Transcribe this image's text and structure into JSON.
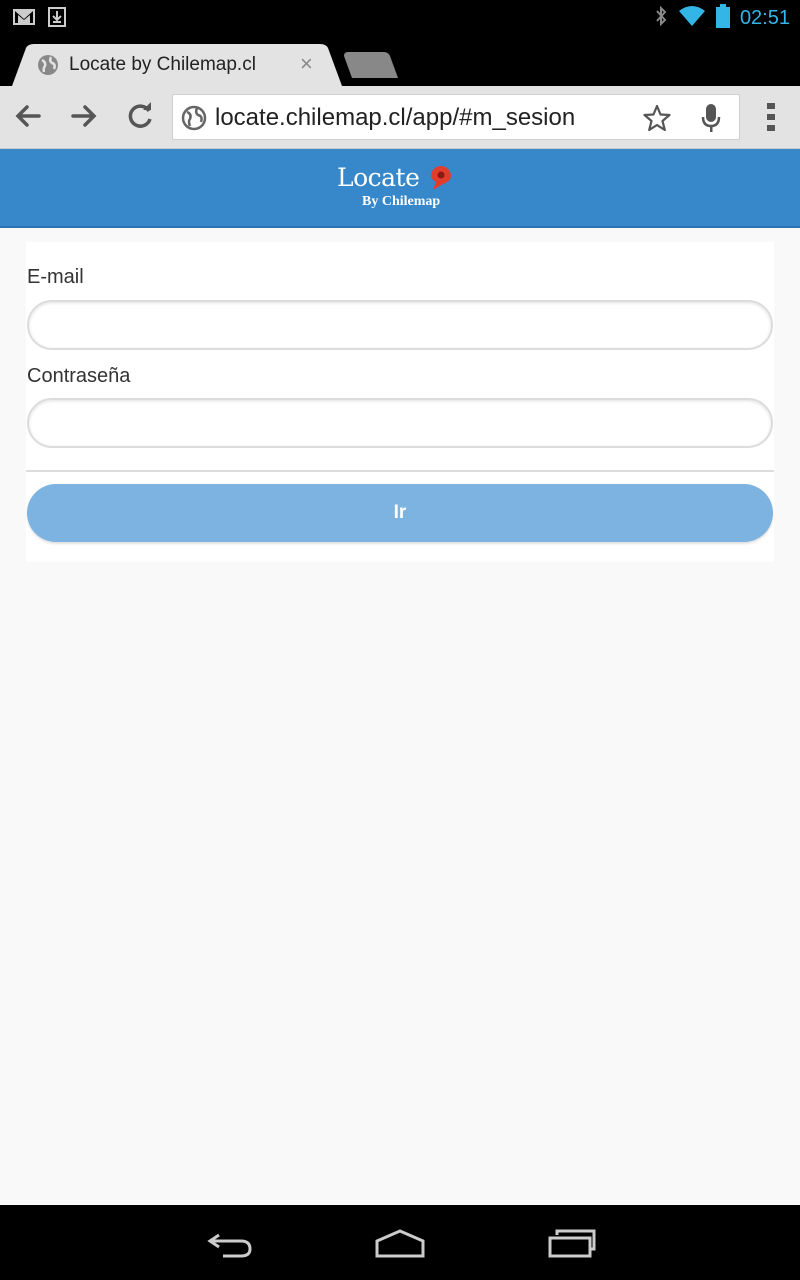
{
  "status_bar": {
    "time": "02:51",
    "icons": [
      "gmail-icon",
      "download-icon",
      "bluetooth-icon",
      "wifi-icon",
      "battery-icon"
    ]
  },
  "browser": {
    "tab": {
      "title": "Locate by Chilemap.cl",
      "close_label": "×"
    },
    "address_bar": {
      "url": "locate.chilemap.cl/app/#m_sesion"
    }
  },
  "app": {
    "logo": {
      "title": "Locate",
      "subtitle": "By Chilemap"
    },
    "header_color": "#3688cb"
  },
  "login_form": {
    "email_label": "E-mail",
    "email_value": "",
    "password_label": "Contraseña",
    "password_value": "",
    "submit_label": "Ir",
    "submit_color": "#7db3e1"
  },
  "nav_bar": {
    "buttons": [
      "back-icon",
      "home-icon",
      "recent-apps-icon"
    ]
  }
}
